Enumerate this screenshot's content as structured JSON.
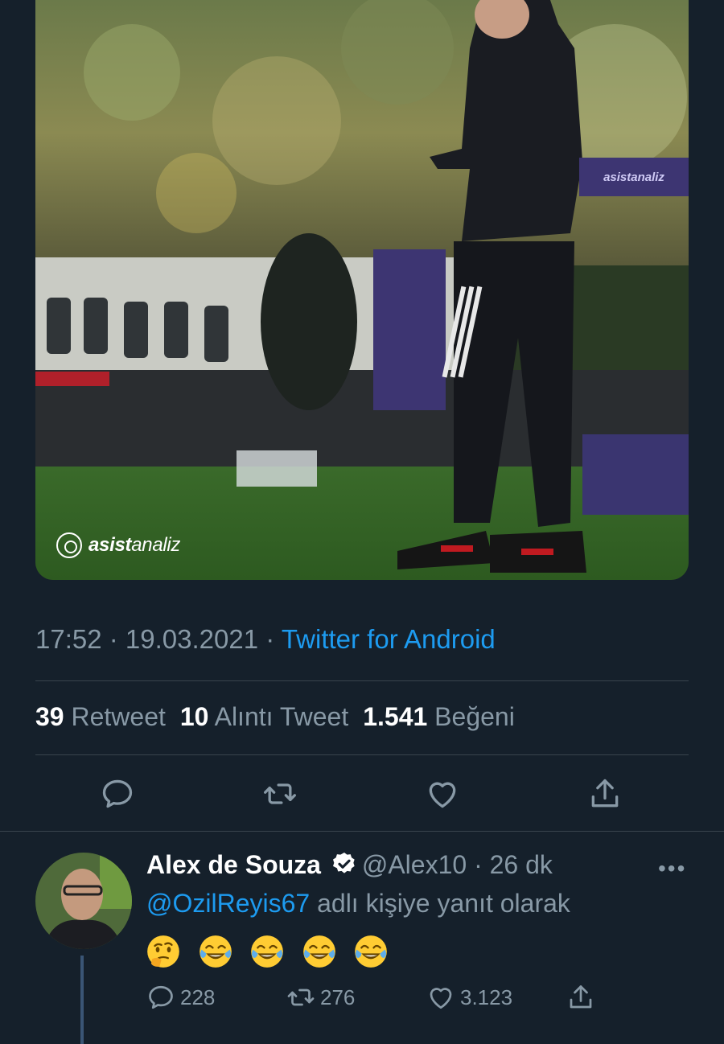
{
  "media": {
    "watermark_bold": "asist",
    "watermark_thin": "analiz",
    "banner_text": "asistanaliz"
  },
  "tweet": {
    "time": "17:52",
    "sep1": " · ",
    "date": "19.03.2021",
    "sep2": " · ",
    "source": "Twitter for Android",
    "retweet_count": "39",
    "retweet_label": "Retweet",
    "quote_count": "10",
    "quote_label": "Alıntı Tweet",
    "like_count": "1.541",
    "like_label": "Beğeni"
  },
  "actions": [
    "reply-icon",
    "retweet-icon",
    "like-icon",
    "share-icon"
  ],
  "reply": {
    "name": "Alex de Souza",
    "handle": "@Alex10",
    "sep": " · ",
    "time": "26 dk",
    "more": "•••",
    "mention": "@OzilReyis67",
    "context_suffix": " adlı kişiye yanıt olarak",
    "emojis": [
      "🤔",
      "😂",
      "😂",
      "😂",
      "😂"
    ],
    "reply_count": "228",
    "retweet_count": "276",
    "like_count": "3.123"
  },
  "colors": {
    "background": "#15202b",
    "link": "#1d9bf0",
    "muted": "#8899a6",
    "divider": "#38444d"
  }
}
